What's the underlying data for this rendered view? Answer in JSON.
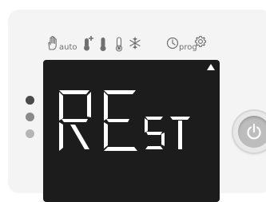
{
  "device": {
    "type": "thermostat-control-panel",
    "modes": {
      "manual_icon": "hand-icon",
      "auto_label": "auto",
      "comfort_plus_icon": "thermometer-plus-icon",
      "comfort_icon": "thermometer-full-icon",
      "eco_icon": "thermometer-low-icon",
      "frost_icon": "snowflake-icon",
      "prog_label": "prog",
      "prog_icon": "clock-icon",
      "settings_icon": "gear-icon"
    },
    "display": {
      "main_text": "RE",
      "secondary_text": "ST",
      "indicator": "triangle-up-icon"
    },
    "leds": [
      {
        "name": "led-1",
        "color": "#4a4a4a"
      },
      {
        "name": "led-2",
        "color": "#8a8a8a"
      },
      {
        "name": "led-3",
        "color": "#b5b5b5"
      }
    ],
    "power_button": {
      "icon": "power-icon"
    },
    "colors": {
      "panel": "#f4f4f4",
      "screen": "#1c1c1c",
      "segment": "#ffffff",
      "icon": "#707070"
    }
  }
}
